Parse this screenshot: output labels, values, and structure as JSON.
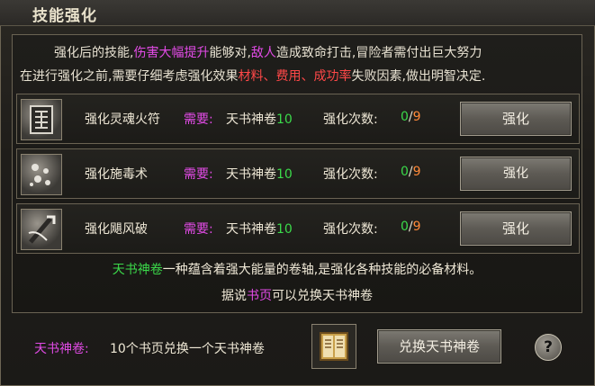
{
  "window": {
    "title": "技能强化"
  },
  "intro": {
    "line1": [
      {
        "t": "强化后的技能,",
        "c": ""
      },
      {
        "t": "伤害大幅提升",
        "c": "m"
      },
      {
        "t": "能够对,",
        "c": ""
      },
      {
        "t": "敌人",
        "c": "m"
      },
      {
        "t": "造成致命打击,冒险者需付出巨大努力",
        "c": ""
      }
    ],
    "line2": [
      {
        "t": "在进行强化之前,需要仔细考虑强化效果",
        "c": ""
      },
      {
        "t": "材料、费用、成功率",
        "c": "r"
      },
      {
        "t": "失败因素,做出明智决定.",
        "c": ""
      }
    ]
  },
  "skills": [
    {
      "icon": "scroll-rune-icon",
      "name": "强化灵魂火符",
      "need_label": "需要:",
      "need_item": "天书神卷",
      "need_qty": "10",
      "times_label": "强化次数:",
      "current": "0",
      "slash": "/",
      "max": "9",
      "button": "强化"
    },
    {
      "icon": "poison-cloud-icon",
      "name": "强化施毒术",
      "need_label": "需要:",
      "need_item": "天书神卷",
      "need_qty": "10",
      "times_label": "强化次数:",
      "current": "0",
      "slash": "/",
      "max": "9",
      "button": "强化"
    },
    {
      "icon": "wind-blade-icon",
      "name": "强化飓风破",
      "need_label": "需要:",
      "need_item": "天书神卷",
      "need_qty": "10",
      "times_label": "强化次数:",
      "current": "0",
      "slash": "/",
      "max": "9",
      "button": "强化"
    }
  ],
  "description": {
    "item_name": "天书神卷",
    "line1_rest": "一种蕴含着强大能量的卷轴,是强化各种技能的必备材料。",
    "line2_pre": "据说",
    "line2_item": "书页",
    "line2_post": "可以兑换天书神卷"
  },
  "footer": {
    "label": "天书神卷:",
    "text": "10个书页兑换一个天书神卷",
    "book_icon": "book-icon",
    "exchange_button": "兑换天书神卷",
    "help_button": "?"
  },
  "colors": {
    "green": "#3bd94a",
    "magenta": "#e24be6",
    "red": "#ff4848",
    "orange": "#ff8a3a"
  }
}
